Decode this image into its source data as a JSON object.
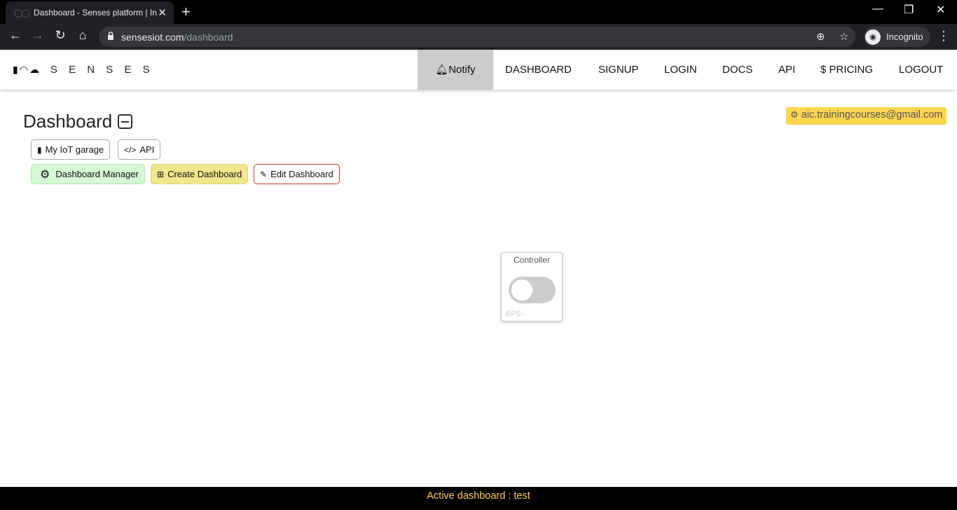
{
  "browser": {
    "tab_title": "Dashboard - Senses platform | In",
    "url_host": "sensesiot.com",
    "url_path": "/dashboard",
    "profile_label": "Incognito"
  },
  "site": {
    "brand_name": "S E N S E S",
    "nav": [
      {
        "label": "Notify",
        "active": true
      },
      {
        "label": "DASHBOARD"
      },
      {
        "label": "SIGNUP"
      },
      {
        "label": "LOGIN"
      },
      {
        "label": "DOCS"
      },
      {
        "label": "API"
      },
      {
        "label": "$ PRICING"
      },
      {
        "label": "LOGOUT"
      }
    ]
  },
  "dashboard": {
    "title": "Dashboard",
    "user_email": "aic.trainingcourses@gmail.com",
    "row1": {
      "garage": "My IoT garage",
      "api": "API"
    },
    "row2": {
      "manager": "Dashboard Manager",
      "create": "Create Dashboard",
      "edit": "Edit Dashboard"
    },
    "widget": {
      "title": "Controller",
      "eps": "EPS:-",
      "state": "off"
    }
  },
  "footer": {
    "text": "Active dashboard : test"
  },
  "colors": {
    "accent_yellow": "#ffd54f",
    "footer_text": "#ffcc66",
    "nav_active": "#cccccc"
  }
}
